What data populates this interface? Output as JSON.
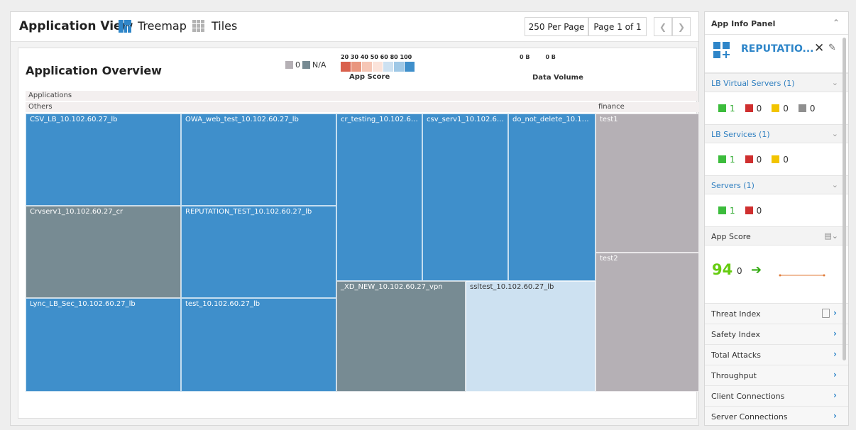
{
  "topbar": {
    "title": "Application View",
    "treemap_label": "Treemap",
    "tiles_label": "Tiles",
    "per_page": "250 Per Page",
    "page_info": "Page 1 of 1",
    "prev_icon": "chevron-left-icon",
    "next_icon": "chevron-right-icon"
  },
  "overview": {
    "title": "Application Overview",
    "legend_zero": "0",
    "legend_na": "N/A",
    "score_ticks": "20 30 40 50 60 80 100",
    "score_label": "App Score",
    "dv_tick_a": "0 B",
    "dv_tick_b": "0 B",
    "dv_label": "Data Volume",
    "group_applications": "Applications",
    "group_others": "Others",
    "group_finance": "finance"
  },
  "tiles": [
    {
      "label": "CSV_LB_10.102.60.27_lb"
    },
    {
      "label": "OWA_web_test_10.102.60.27_lb"
    },
    {
      "label": "cr_testing_10.102.60...."
    },
    {
      "label": "csv_serv1_10.102.60...."
    },
    {
      "label": "do_not_delete_10.10..."
    },
    {
      "label": "test1"
    },
    {
      "label": "Crvserv1_10.102.60.27_cr"
    },
    {
      "label": "REPUTATION_TEST_10.102.60.27_lb"
    },
    {
      "label": "test2"
    },
    {
      "label": "_XD_NEW_10.102.60.27_vpn"
    },
    {
      "label": "ssltest_10.102.60.27_lb"
    },
    {
      "label": "Lync_LB_Sec_10.102.60.27_lb"
    },
    {
      "label": "test_10.102.60.27_lb"
    }
  ],
  "colors": {
    "score_high": "#3f8fcb",
    "score_light": "#cde1f1",
    "na_gray": "#778b93",
    "zero_gray": "#b5b0b5",
    "score_low": [
      "#d9604c",
      "#e9967e",
      "#f6c6b5",
      "#fbe3da",
      "#cde1f1",
      "#9fc8e6",
      "#3f8fcb"
    ]
  },
  "panel": {
    "title": "App Info Panel",
    "app_name": "REPUTATIO...",
    "lb_vservers": "LB Virtual Servers (1)",
    "lb_vservers_counts": [
      "1",
      "0",
      "0",
      "0"
    ],
    "lb_services": "LB Services (1)",
    "lb_services_counts": [
      "1",
      "0",
      "0"
    ],
    "servers": "Servers (1)",
    "servers_counts": [
      "1",
      "0"
    ],
    "app_score_label": "App Score",
    "app_score": "94",
    "app_score_delta": "0",
    "rows": [
      "Threat Index",
      "Safety Index",
      "Total Attacks",
      "Throughput",
      "Client Connections",
      "Server Connections"
    ]
  }
}
